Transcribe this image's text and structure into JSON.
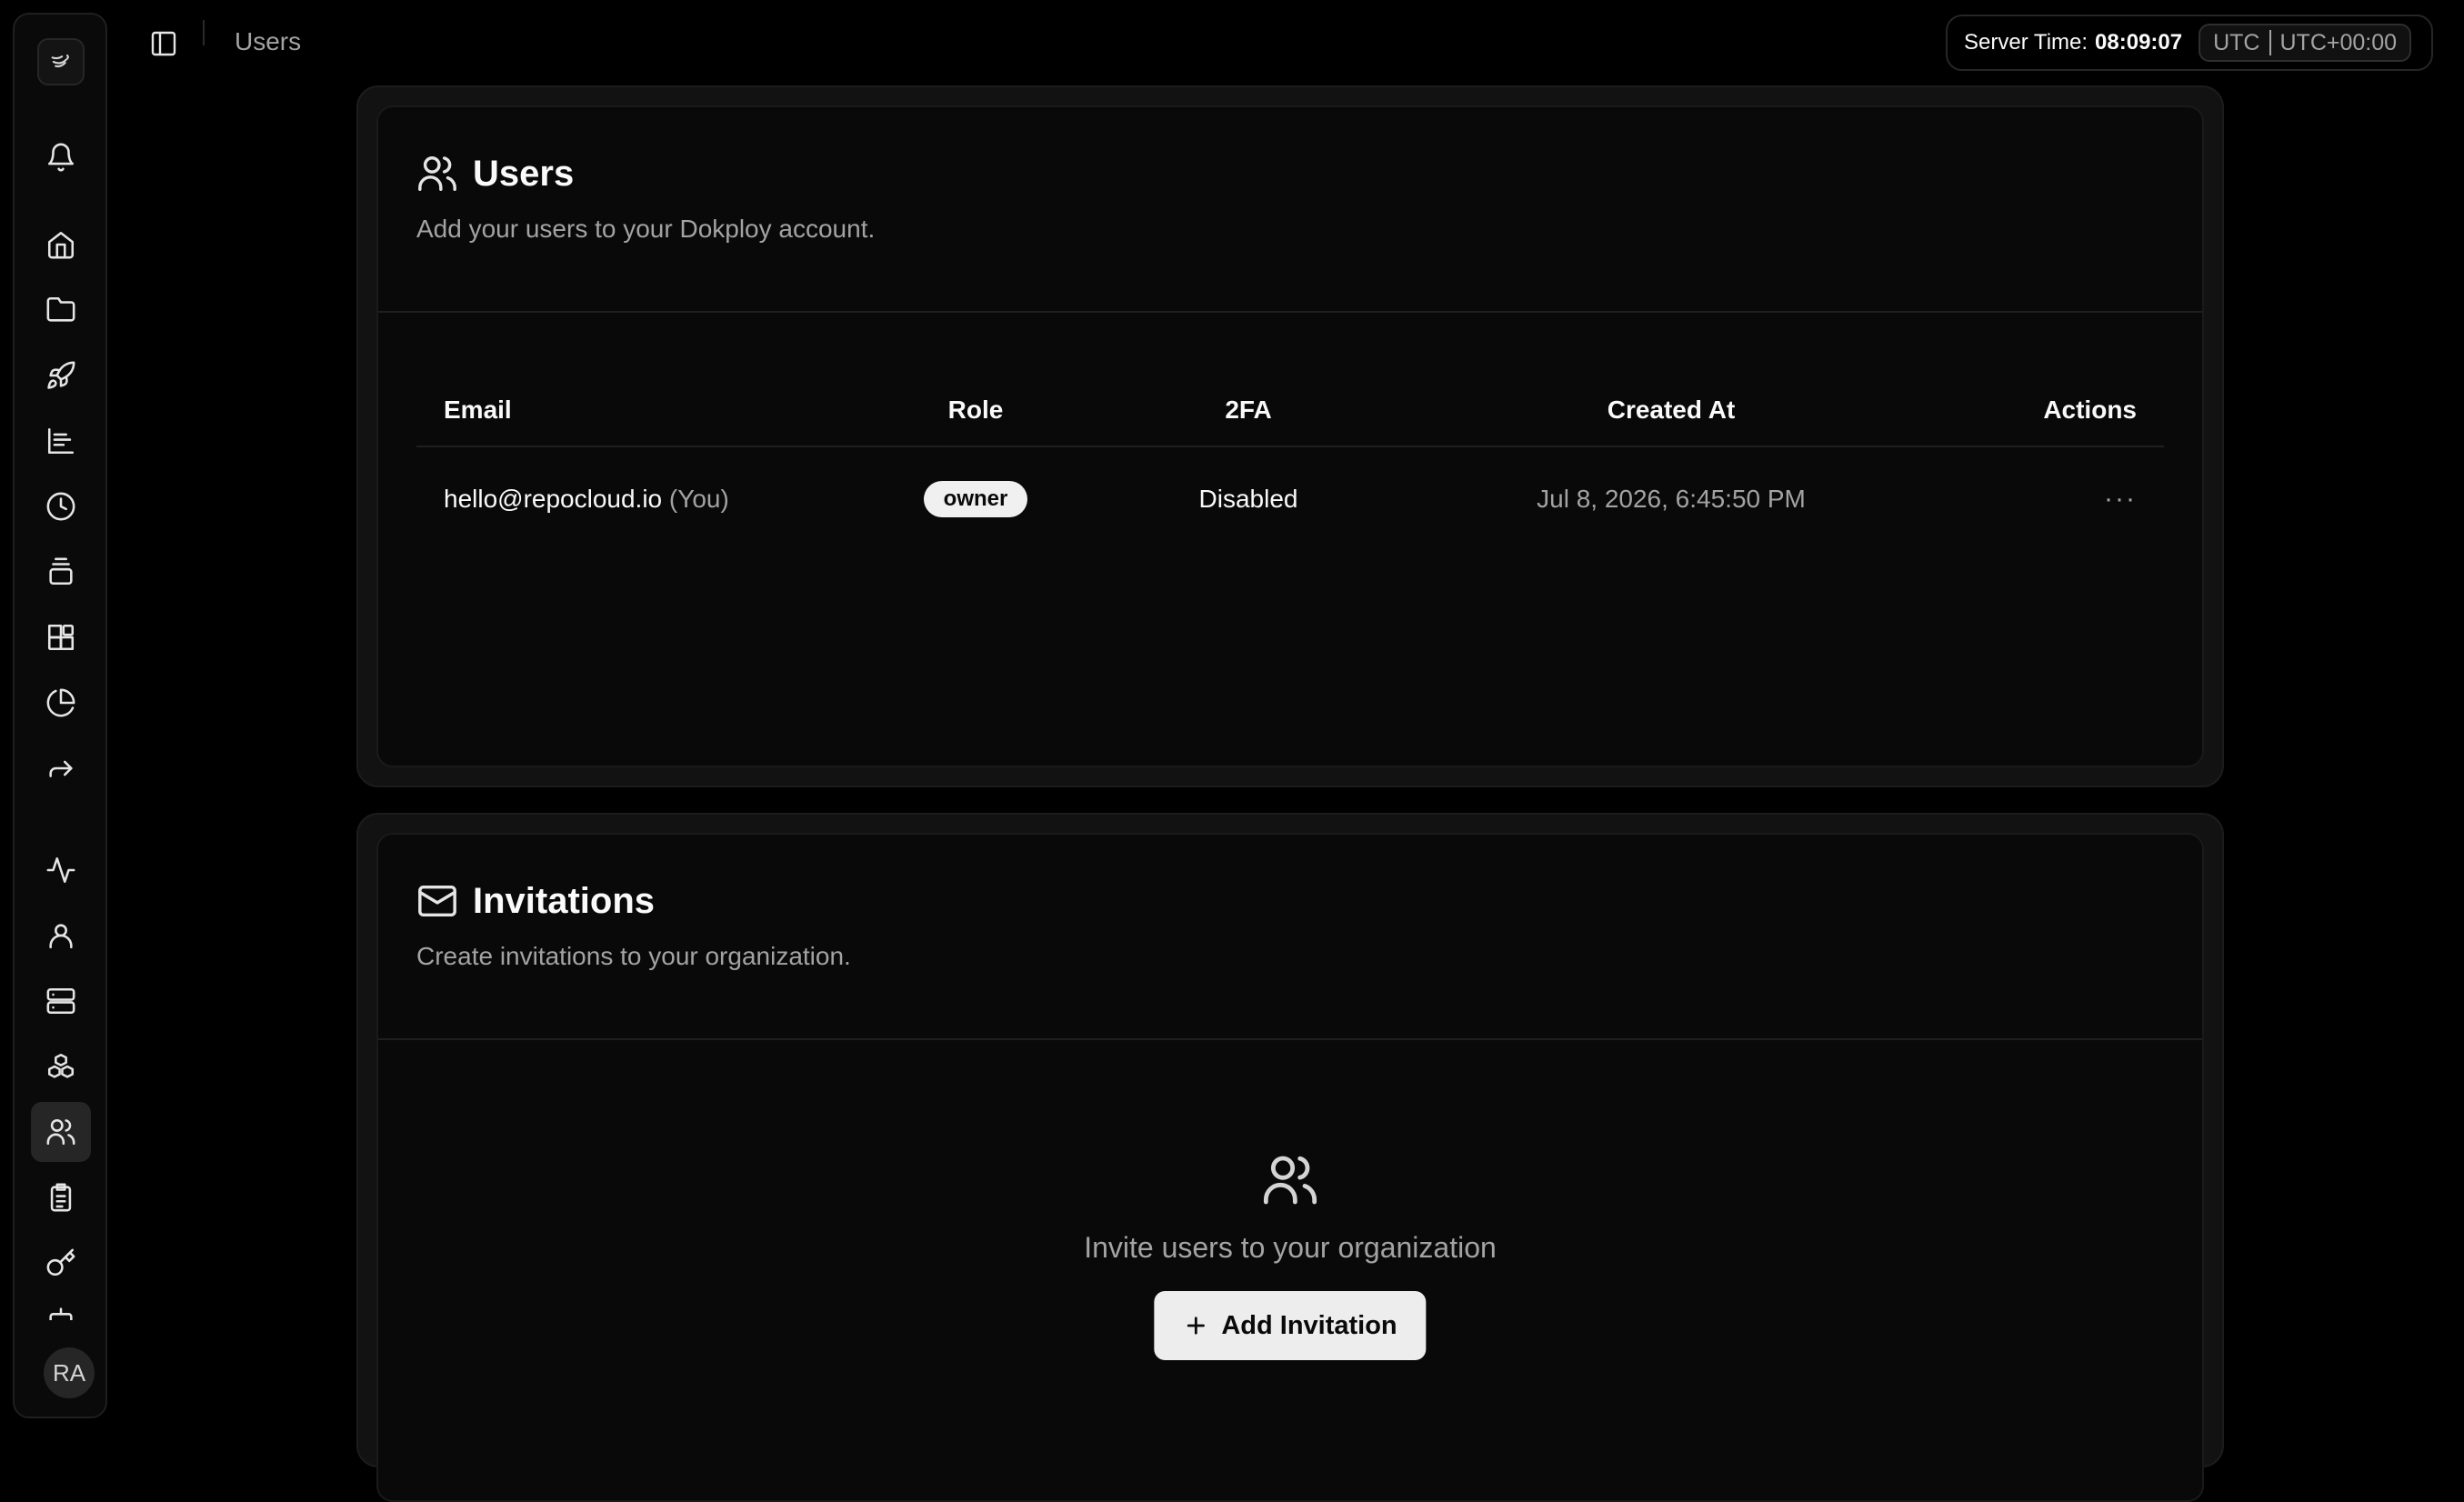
{
  "sidebar": {
    "items": [
      {
        "icon": "bell-icon"
      },
      {
        "icon": "home-icon"
      },
      {
        "icon": "folder-icon"
      },
      {
        "icon": "rocket-icon"
      },
      {
        "icon": "chart-bars-icon"
      },
      {
        "icon": "clock-icon"
      },
      {
        "icon": "layers-icon"
      },
      {
        "icon": "blocks-icon"
      },
      {
        "icon": "pie-chart-icon"
      },
      {
        "icon": "forward-icon"
      },
      {
        "icon": "activity-icon"
      },
      {
        "icon": "user-icon"
      },
      {
        "icon": "server-icon"
      },
      {
        "icon": "boxes-icon"
      },
      {
        "icon": "users-icon",
        "active": true
      },
      {
        "icon": "clipboard-icon"
      },
      {
        "icon": "key-icon"
      }
    ],
    "avatar_initials": "RA"
  },
  "header": {
    "breadcrumb": "Users",
    "server_time_label": "Server Time:",
    "server_time_value": "08:09:07",
    "timezone": "UTC",
    "timezone_offset": "UTC+00:00"
  },
  "users_card": {
    "title": "Users",
    "description": "Add your users to your Dokploy account.",
    "columns": [
      "Email",
      "Role",
      "2FA",
      "Created At",
      "Actions"
    ],
    "rows": [
      {
        "email": "hello@repocloud.io",
        "you_label": "(You)",
        "role": "owner",
        "twofa": "Disabled",
        "created_at": "Jul 8, 2026, 6:45:50 PM",
        "actions_label": "···"
      }
    ]
  },
  "invitations_card": {
    "title": "Invitations",
    "description": "Create invitations to your organization.",
    "empty_text": "Invite users to your organization",
    "add_button_label": "Add Invitation"
  },
  "colors": {
    "background": "#000000",
    "card": "#090909",
    "muted_text": "#a3a3a3",
    "button_bg": "#ededed"
  }
}
